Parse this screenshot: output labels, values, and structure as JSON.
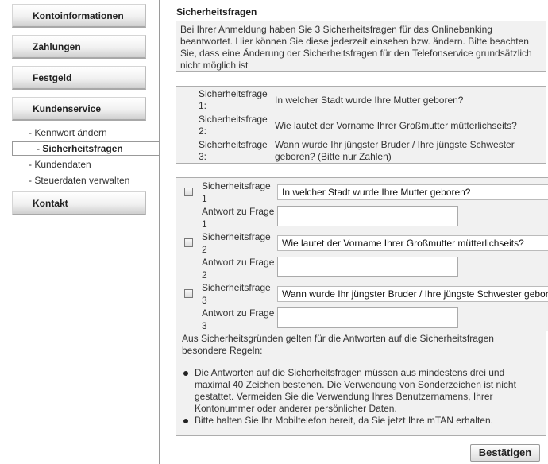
{
  "sidebar": {
    "nav": [
      {
        "label": "Kontoinformationen"
      },
      {
        "label": "Zahlungen"
      },
      {
        "label": "Festgeld"
      },
      {
        "label": "Kundenservice"
      },
      {
        "label": "Kontakt"
      }
    ],
    "subitems": [
      {
        "label": "- Kennwort ändern"
      },
      {
        "label": "- Sicherheitsfragen"
      },
      {
        "label": "- Kundendaten"
      },
      {
        "label": "- Steuerdaten verwalten"
      }
    ]
  },
  "main": {
    "title": "Sicherheitsfragen",
    "intro": "Bei Ihrer Anmeldung haben Sie 3 Sicherheitsfragen für das Onlinebanking beantwortet. Hier können Sie diese jederzeit einsehen bzw. ändern. Bitte beachten Sie, dass eine Änderung der Sicherheitsfragen für den Telefonservice grundsätzlich nicht möglich ist",
    "overview": [
      {
        "label": "Sicherheitsfrage 1:",
        "question": "In welcher Stadt wurde Ihre Mutter geboren?"
      },
      {
        "label": "Sicherheitsfrage 2:",
        "question": "Wie lautet der Vorname Ihrer Großmutter mütterlichseits?"
      },
      {
        "label": "Sicherheitsfrage 3:",
        "question": "Wann wurde Ihr jüngster Bruder / Ihre jüngste Schwester geboren? (Bitte nur Zahlen)"
      }
    ],
    "form": [
      {
        "question_label": "Sicherheitsfrage 1",
        "selected": "In welcher Stadt wurde Ihre Mutter geboren?",
        "answer_label": "Antwort zu Frage 1",
        "answer_value": ""
      },
      {
        "question_label": "Sicherheitsfrage 2",
        "selected": "Wie lautet der Vorname Ihrer Großmutter mütterlichseits?",
        "answer_label": "Antwort zu Frage 2",
        "answer_value": ""
      },
      {
        "question_label": "Sicherheitsfrage 3",
        "selected": "Wann wurde Ihr jüngster Bruder / Ihre jüngste Schwester geboren? (Bitte nur Zahlen)",
        "answer_label": "Antwort zu Frage 3",
        "answer_value": ""
      }
    ],
    "rules_intro": "Aus Sicherheitsgründen gelten für die Antworten auf die Sicherheitsfragen besondere Regeln:",
    "rules": [
      "Die Antworten auf die Sicherheitsfragen müssen aus mindestens drei und maximal 40 Zeichen bestehen. Die Verwendung von Sonderzeichen ist nicht gestattet. Vermeiden Sie die Verwendung Ihres Benutzernamens, Ihrer Kontonummer oder anderer persönlicher Daten.",
      "Bitte halten Sie Ihr Mobiltelefon bereit, da Sie jetzt Ihre mTAN erhalten."
    ],
    "confirm_label": "Bestätigen"
  }
}
